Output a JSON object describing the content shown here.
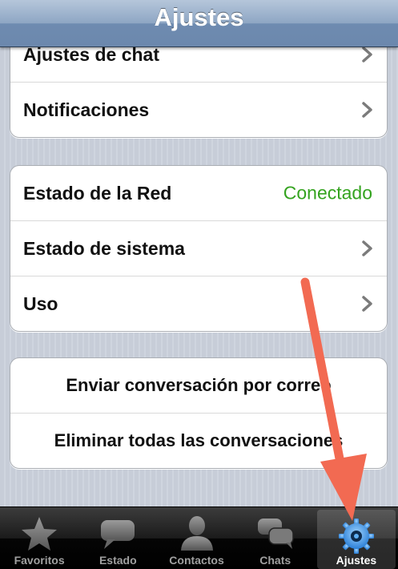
{
  "header": {
    "title": "Ajustes"
  },
  "groups": {
    "first": [
      {
        "label": "Ajustes de chat"
      },
      {
        "label": "Notificaciones"
      }
    ],
    "second": [
      {
        "label": "Estado de la Red",
        "value": "Conectado"
      },
      {
        "label": "Estado de sistema"
      },
      {
        "label": "Uso"
      }
    ],
    "third": [
      {
        "label": "Enviar conversación por correo"
      },
      {
        "label": "Eliminar todas las conversaciones"
      }
    ]
  },
  "tabbar": {
    "tabs": [
      {
        "label": "Favoritos",
        "icon": "star-icon"
      },
      {
        "label": "Estado",
        "icon": "speech-bubble-icon"
      },
      {
        "label": "Contactos",
        "icon": "person-icon"
      },
      {
        "label": "Chats",
        "icon": "chat-bubbles-icon"
      },
      {
        "label": "Ajustes",
        "icon": "gear-icon",
        "active": true
      }
    ]
  },
  "colors": {
    "status_value": "#34a31f",
    "annotation_arrow": "#f26a52",
    "active_tab_icon": "#3d9be9"
  }
}
